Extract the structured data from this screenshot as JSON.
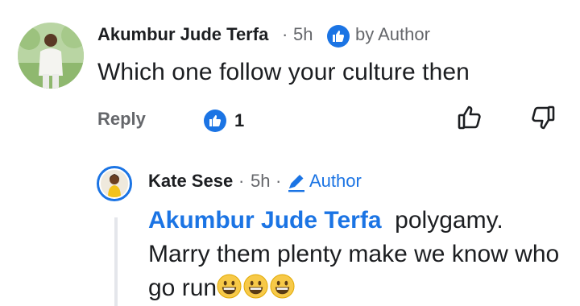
{
  "comment": {
    "author": "Akumbur Jude Terfa",
    "separator": "·",
    "time": "5h",
    "author_badge": "by Author",
    "text": "Which one follow your culture then",
    "reply_label": "Reply",
    "reaction_count": "1",
    "reaction_type": "like"
  },
  "reply": {
    "author": "Kate Sese",
    "separator": "·",
    "time": "5h",
    "author_badge": "Author",
    "mention": "Akumbur Jude Terfa",
    "text_line": "polygamy. Marry them plenty make we know who go run",
    "emojis": [
      "grinning-face",
      "grinning-face",
      "grinning-face"
    ]
  },
  "colors": {
    "accent": "#1b74e4",
    "secondary_text": "#65676b",
    "primary_text": "#1c1e21"
  }
}
